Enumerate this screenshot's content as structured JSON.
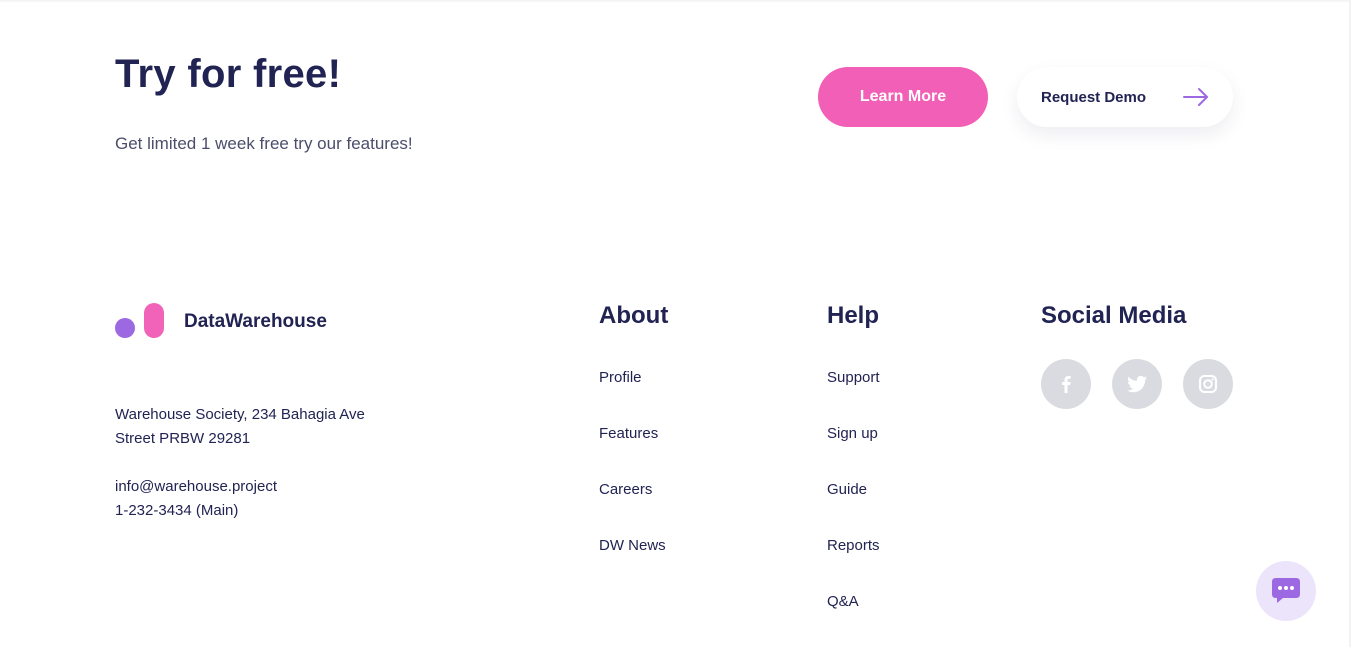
{
  "cta": {
    "title": "Try for free!",
    "subtitle": "Get limited 1 week free try our features!",
    "learn_more_label": "Learn More",
    "request_demo_label": "Request Demo"
  },
  "brand": {
    "name": "DataWarehouse",
    "address_line1": "Warehouse Society, 234 Bahagia Ave",
    "address_line2": "Street PRBW 29281",
    "email": "info@warehouse.project",
    "phone": "1-232-3434 (Main)"
  },
  "footer": {
    "about": {
      "title": "About",
      "links": [
        "Profile",
        "Features",
        "Careers",
        "DW News"
      ]
    },
    "help": {
      "title": "Help",
      "links": [
        "Support",
        "Sign up",
        "Guide",
        "Reports",
        "Q&A"
      ]
    },
    "social": {
      "title": "Social Media",
      "icons": [
        "facebook-icon",
        "twitter-icon",
        "instagram-icon"
      ]
    }
  },
  "colors": {
    "navy": "#212353",
    "pink": "#f15fb6",
    "purple": "#9c69e2",
    "social_bg": "#d9dbe1",
    "chat_bg": "#ece4fb"
  }
}
